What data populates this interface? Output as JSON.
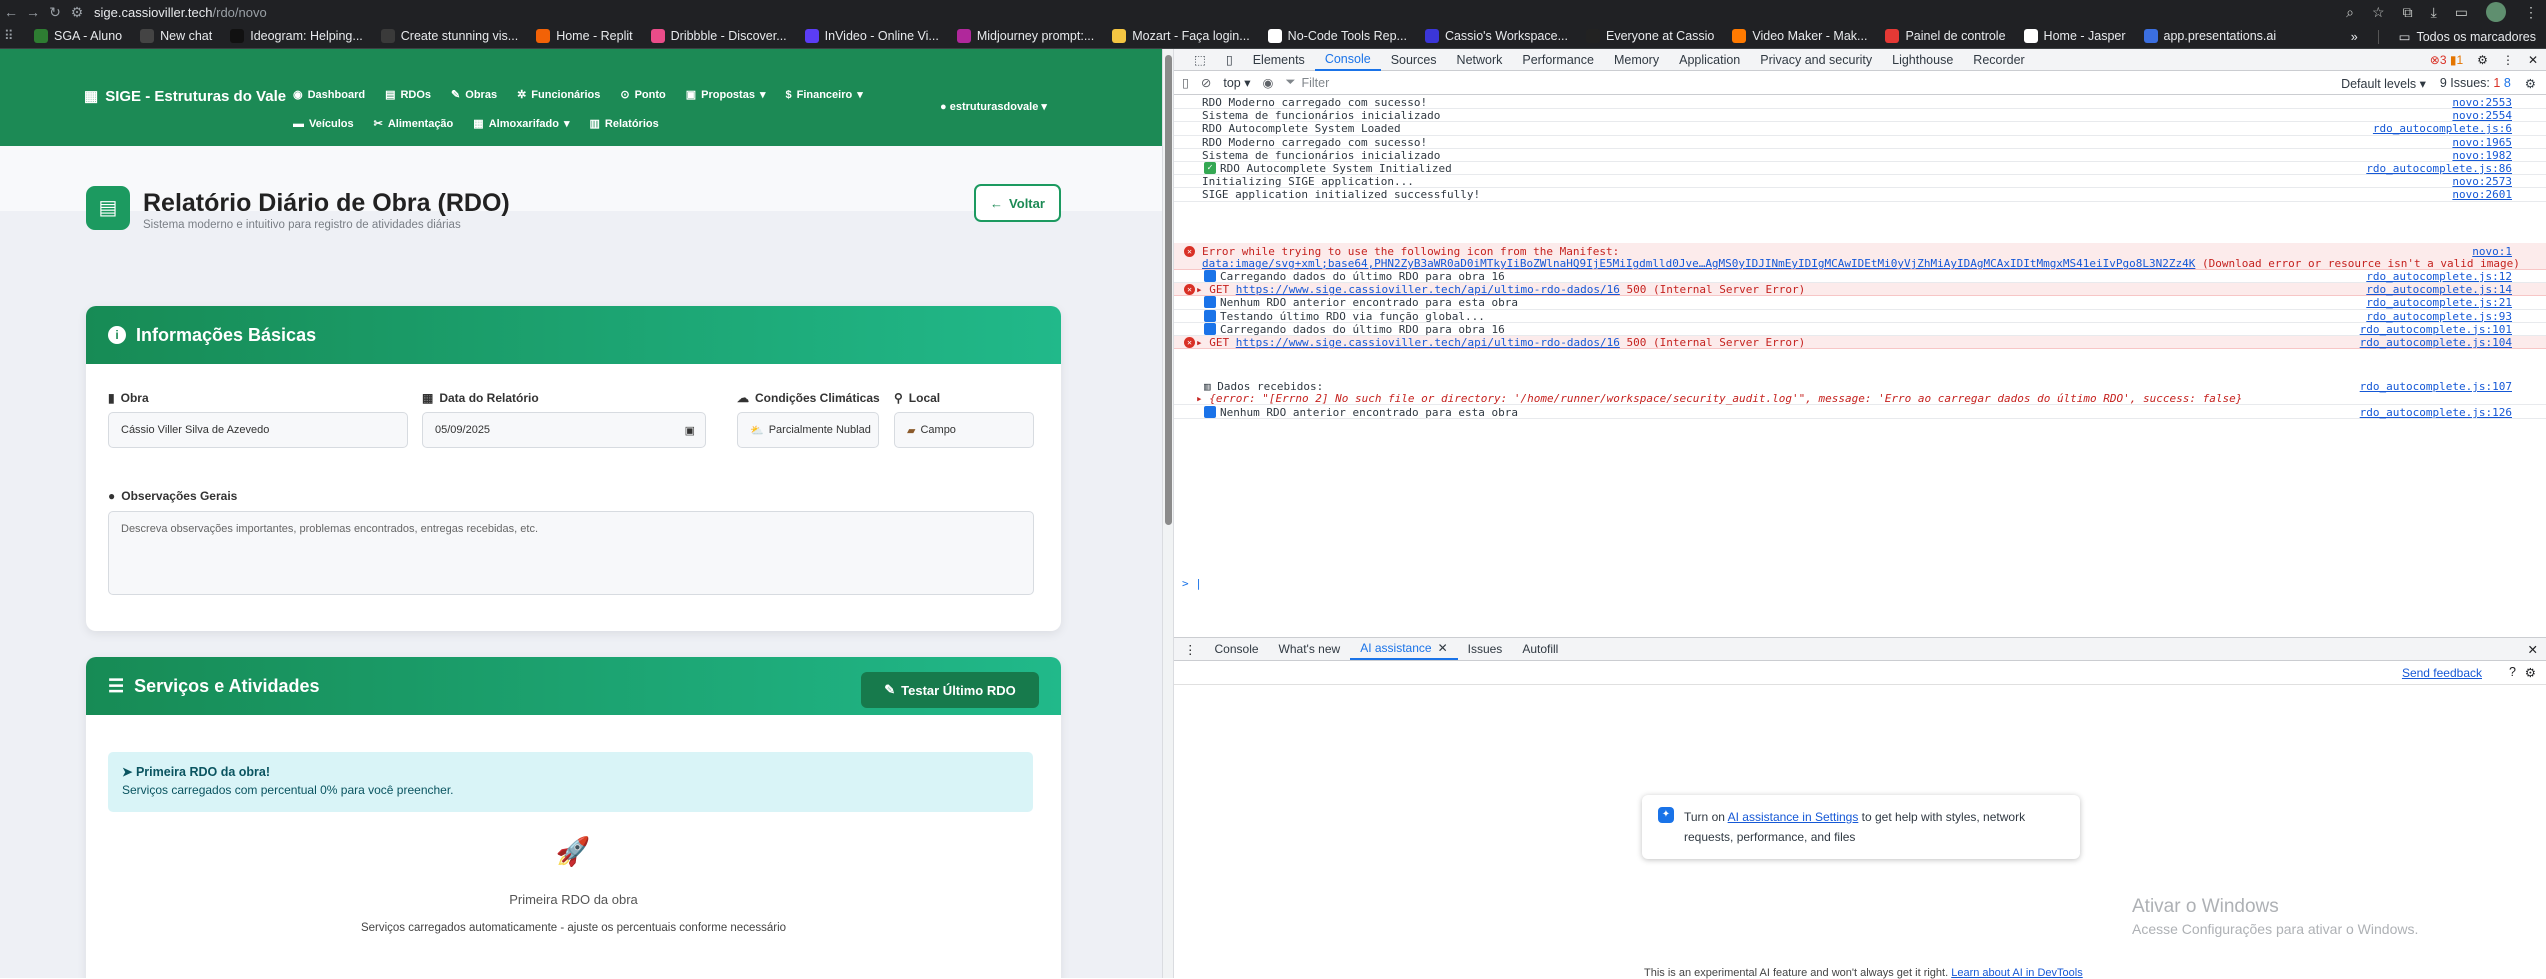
{
  "browser": {
    "url_host": "sige.cassioviller.tech",
    "url_path": "/rdo/novo",
    "bookmarks": [
      {
        "label": "SGA - Aluno",
        "color": "#2e7d32"
      },
      {
        "label": "New chat",
        "color": "#444444"
      },
      {
        "label": "Ideogram: Helping...",
        "color": "#111111"
      },
      {
        "label": "Create stunning vis...",
        "color": "#3a3a3a"
      },
      {
        "label": "Home - Replit",
        "color": "#f26207"
      },
      {
        "label": "Dribbble - Discover...",
        "color": "#ea4c89"
      },
      {
        "label": "InVideo - Online Vi...",
        "color": "#5b3df5"
      },
      {
        "label": "Midjourney prompt:...",
        "color": "#b0289b"
      },
      {
        "label": "Mozart - Faça login...",
        "color": "#f4c542"
      },
      {
        "label": "No-Code Tools Rep...",
        "color": "#ffffff"
      },
      {
        "label": "Cassio's Workspace...",
        "color": "#3b36d8"
      },
      {
        "label": "Everyone at Cassio",
        "color": "#222222"
      },
      {
        "label": "Video Maker - Mak...",
        "color": "#ff7a00"
      },
      {
        "label": "Painel de controle",
        "color": "#e53935"
      },
      {
        "label": "Home - Jasper",
        "color": "#ffffff"
      },
      {
        "label": "app.presentations.ai",
        "color": "#3b6fe0"
      }
    ],
    "all_bookmarks": "Todos os marcadores"
  },
  "app": {
    "brand": "SIGE - Estruturas do Vale",
    "menu_row1": [
      "Dashboard",
      "RDOs",
      "Obras",
      "Funcionários",
      "Ponto",
      "Propostas",
      "Financeiro"
    ],
    "menu_row2": [
      "Veículos",
      "Alimentação",
      "Almoxarifado",
      "Relatórios"
    ],
    "user": "estruturasdovale",
    "page_title": "Relatório Diário de Obra (RDO)",
    "page_subtitle": "Sistema moderno e intuitivo para registro de atividades diárias",
    "back_button": "Voltar",
    "basic_info": {
      "title": "Informações Básicas",
      "obra_label": "Obra",
      "obra_value": "Cássio Viller Silva de Azevedo",
      "date_label": "Data do Relatório",
      "date_value": "05/09/2025",
      "weather_label": "Condições Climáticas",
      "weather_value": "Parcialmente Nublad",
      "local_label": "Local",
      "local_value": "Campo",
      "obs_label": "Observações Gerais",
      "obs_placeholder": "Descreva observações importantes, problemas encontrados, entregas recebidas, etc."
    },
    "services": {
      "title": "Serviços e Atividades",
      "test_button": "Testar Último RDO",
      "alert_title": "Primeira RDO da obra!",
      "alert_text": "Serviços carregados com percentual 0% para você preencher.",
      "empty_title": "Primeira RDO da obra",
      "empty_text": "Serviços carregados automaticamente - ajuste os percentuais conforme necessário"
    }
  },
  "devtools": {
    "tabs": [
      "Elements",
      "Console",
      "Sources",
      "Network",
      "Performance",
      "Memory",
      "Application",
      "Privacy and security",
      "Lighthouse",
      "Recorder"
    ],
    "error_count": "3",
    "warn_count": "1",
    "context": "top",
    "filter_placeholder": "Filter",
    "levels": "Default levels",
    "issues_label": "9 Issues:",
    "issues_err": "1",
    "issues_info": "8",
    "console_rows": [
      {
        "type": "log",
        "text": "RDO Moderno carregado com sucesso!",
        "src": "novo:2553"
      },
      {
        "type": "log",
        "text": "Sistema de funcionários inicializado",
        "src": "novo:2554"
      },
      {
        "type": "log",
        "text": "RDO Autocomplete System Loaded",
        "src": "rdo_autocomplete.js:6"
      },
      {
        "type": "log",
        "text": "RDO Moderno carregado com sucesso!",
        "src": "novo:1965"
      },
      {
        "type": "log",
        "text": "Sistema de funcionários inicializado",
        "src": "novo:1982"
      },
      {
        "type": "green",
        "text": "RDO Autocomplete System Initialized",
        "src": "rdo_autocomplete.js:86"
      },
      {
        "type": "log",
        "text": "Initializing SIGE application...",
        "src": "novo:2573"
      },
      {
        "type": "log",
        "text": "SIGE application initialized successfully!",
        "src": "novo:2601"
      }
    ],
    "manifest_error": {
      "line1": "Error while trying to use the following icon from the Manifest:",
      "link": "data:image/svg+xml;base64,PHN2ZyB3aWR0aD0iMTkyIiBoZWlnaHQ9IjE5MiIgdmlld0Jve…AgMS0yIDJINmEyIDIgMCAwIDEtMi0yVjZhMiAyIDAgMCAxIDItMmgxMS41eiIvPgo8L3N2Zz4K",
      "tail": "(Download error or resource isn't a valid image)",
      "src": "novo:1"
    },
    "rows2": [
      {
        "type": "info",
        "text": "Carregando dados do último RDO para obra 16",
        "src": "rdo_autocomplete.js:12"
      },
      {
        "type": "err",
        "prefix": "GET",
        "link": "https://www.sige.cassioviller.tech/api/ultimo-rdo-dados/16",
        "text": "500 (Internal Server Error)",
        "src": "rdo_autocomplete.js:14"
      },
      {
        "type": "info",
        "text": "Nenhum RDO anterior encontrado para esta obra",
        "src": "rdo_autocomplete.js:21"
      },
      {
        "type": "info",
        "text": "Testando último RDO via função global...",
        "src": "rdo_autocomplete.js:93"
      },
      {
        "type": "info",
        "text": "Carregando dados do último RDO para obra 16",
        "src": "rdo_autocomplete.js:101"
      },
      {
        "type": "err",
        "prefix": "GET",
        "link": "https://www.sige.cassioviller.tech/api/ultimo-rdo-dados/16",
        "text": "500 (Internal Server Error)",
        "src": "rdo_autocomplete.js:104"
      }
    ],
    "data_received": {
      "label": "Dados recebidos:",
      "object": "{error: \"[Errno 2] No such file or directory: '/home/runner/workspace/security_audit.log'\", message: 'Erro ao carregar dados do último RDO', success: false}",
      "src": "rdo_autocomplete.js:107"
    },
    "last_row": {
      "text": "Nenhum RDO anterior encontrado para esta obra",
      "src": "rdo_autocomplete.js:126"
    },
    "drawer_tabs": [
      "Console",
      "What's new",
      "AI assistance",
      "Issues",
      "Autofill"
    ],
    "send_feedback": "Send feedback",
    "ai_text_before": "Turn on ",
    "ai_link": "AI assistance in Settings",
    "ai_text_after": " to get help with styles, network requests, performance, and files",
    "windows_title": "Ativar o Windows",
    "windows_sub": "Acesse Configurações para ativar o Windows.",
    "footer_text": "This is an experimental AI feature and won't always get it right.",
    "footer_link": "Learn about AI in DevTools"
  }
}
